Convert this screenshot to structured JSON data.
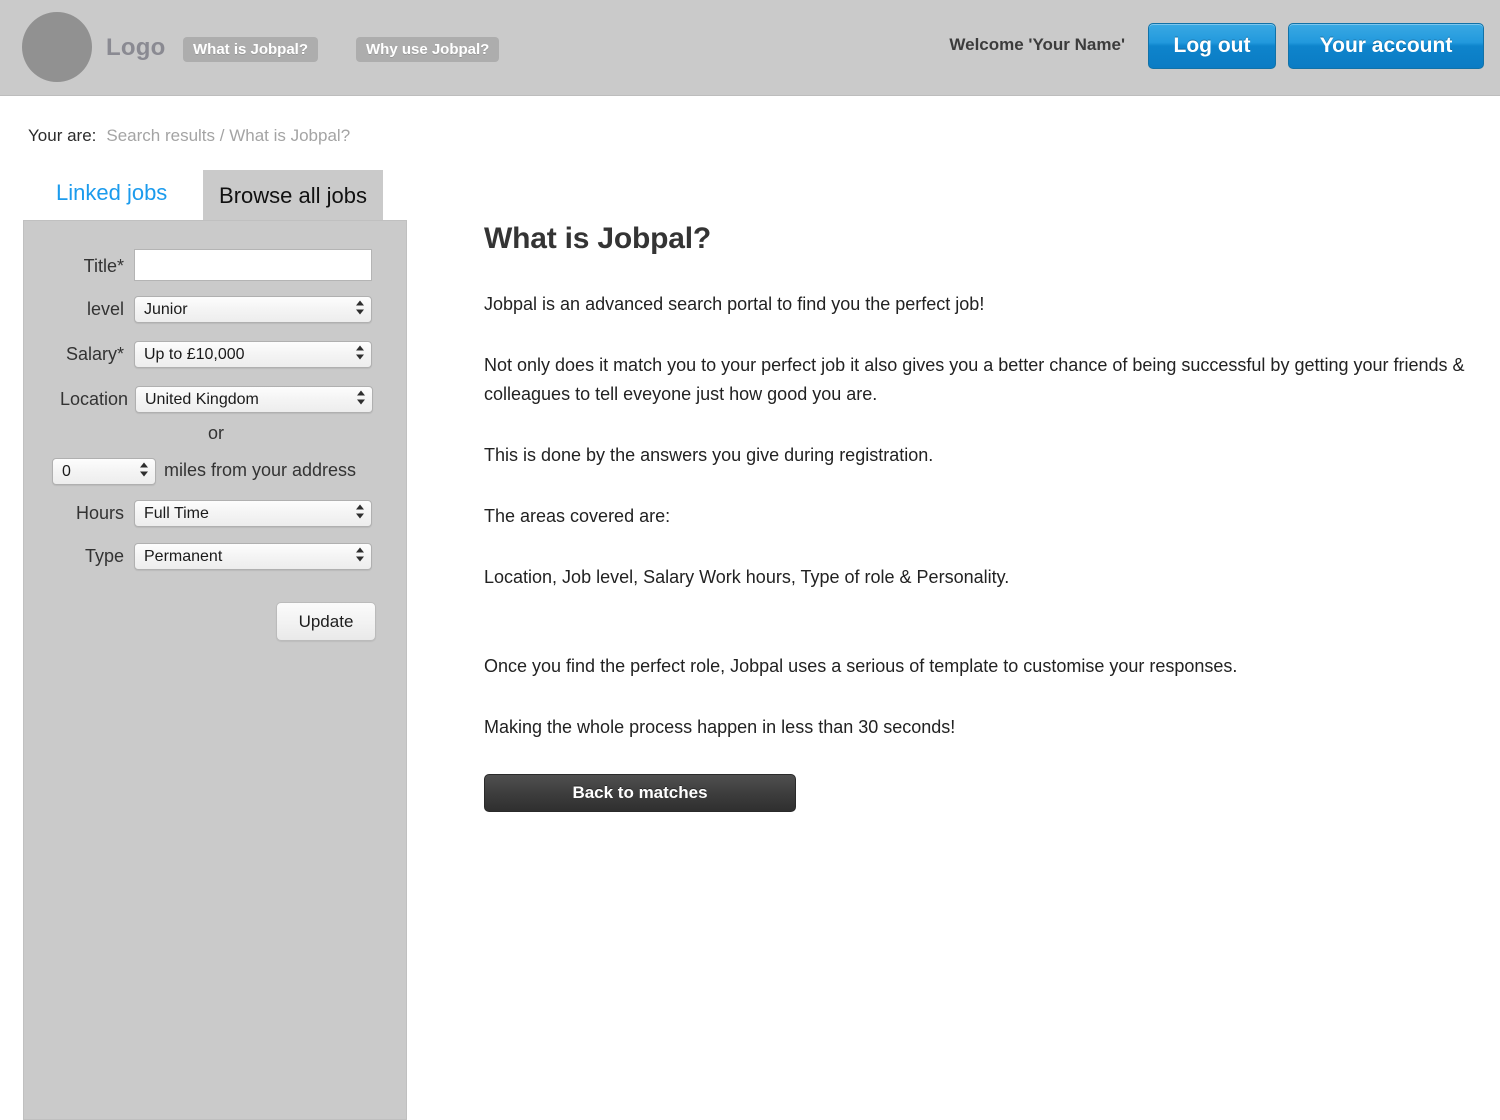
{
  "header": {
    "logo_label": "Logo",
    "nav_items": [
      {
        "label": "What is Jobpal?"
      },
      {
        "label": "Why use Jobpal?"
      }
    ],
    "welcome": "Welcome 'Your Name'",
    "logout_label": "Log out",
    "account_label": "Your account",
    "background_color": "#cacaca",
    "button_color": "#2299dd"
  },
  "breadcrumb": {
    "label": "Your are:",
    "path": "Search results / What is Jobpal?"
  },
  "tabs": [
    {
      "label": "Linked jobs",
      "active": false
    },
    {
      "label": "Browse all jobs",
      "active": true
    }
  ],
  "sidebar": {
    "fields": {
      "title": {
        "label": "Title*",
        "value": "",
        "placeholder": ""
      },
      "level": {
        "label": "level",
        "value": "Junior"
      },
      "salary": {
        "label": "Salary*",
        "value": "Up to £10,000"
      },
      "location": {
        "label": "Location",
        "value": "United Kingdom"
      },
      "or": {
        "label": "or"
      },
      "miles": {
        "value": "0",
        "suffix": "miles from your address"
      },
      "hours": {
        "label": "Hours",
        "value": "Full Time"
      },
      "type": {
        "label": "Type",
        "value": "Permanent"
      }
    },
    "update_label": "Update"
  },
  "main": {
    "heading": "What is Jobpal?",
    "paragraphs": [
      "Jobpal is an advanced search portal to find you the perfect job!",
      "Not only does it match you to your perfect job it also gives you a better chance of being successful by getting your friends & colleagues to tell eveyone just how good you are.",
      "This is done by the answers you give during registration.",
      "The areas covered are:",
      "Location, Job level, Salary Work hours, Type of role & Personality.",
      "Once you find the perfect role, Jobpal uses a serious of template to customise your responses.",
      "Making the whole process happen in less than 30 seconds!"
    ],
    "back_button_label": "Back to matches"
  }
}
